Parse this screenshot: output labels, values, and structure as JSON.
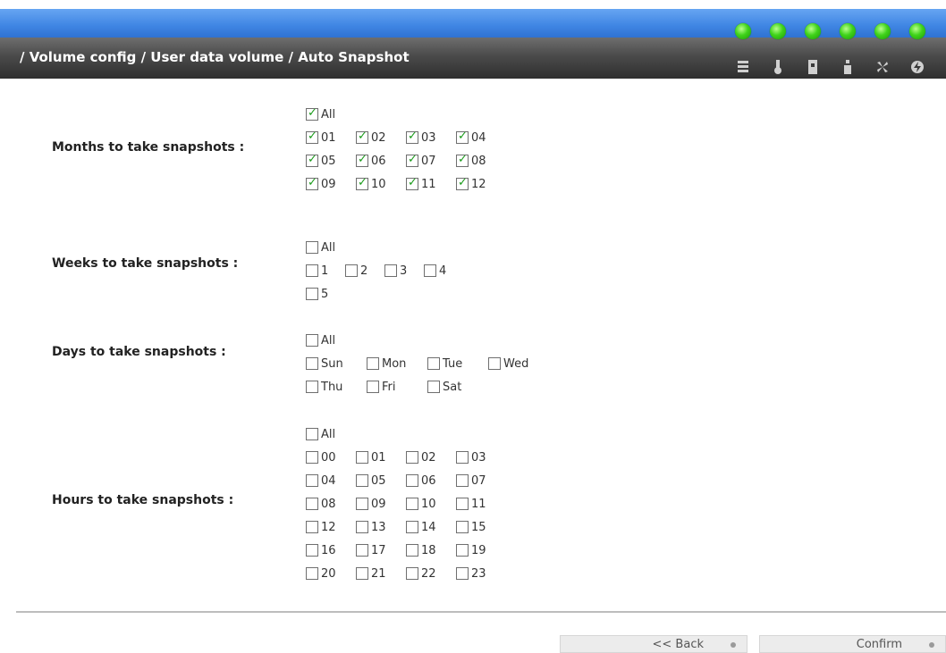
{
  "header": {
    "breadcrumb": "/ Volume config / User data volume / Auto Snapshot",
    "status_icons": [
      "disk-icon",
      "temperature-icon",
      "power-supply-icon",
      "ups-icon",
      "fan-icon",
      "voltage-icon"
    ],
    "led_color": "#3fd31a"
  },
  "months": {
    "label": "Months to take snapshots :",
    "all": {
      "label": "All",
      "checked": true
    },
    "options": [
      {
        "label": "01",
        "checked": true
      },
      {
        "label": "02",
        "checked": true
      },
      {
        "label": "03",
        "checked": true
      },
      {
        "label": "04",
        "checked": true
      },
      {
        "label": "05",
        "checked": true
      },
      {
        "label": "06",
        "checked": true
      },
      {
        "label": "07",
        "checked": true
      },
      {
        "label": "08",
        "checked": true
      },
      {
        "label": "09",
        "checked": true
      },
      {
        "label": "10",
        "checked": true
      },
      {
        "label": "11",
        "checked": true
      },
      {
        "label": "12",
        "checked": true
      }
    ]
  },
  "weeks": {
    "label": "Weeks to take snapshots :",
    "all": {
      "label": "All",
      "checked": false
    },
    "options": [
      {
        "label": "1",
        "checked": false
      },
      {
        "label": "2",
        "checked": false
      },
      {
        "label": "3",
        "checked": false
      },
      {
        "label": "4",
        "checked": false
      },
      {
        "label": "5",
        "checked": false
      }
    ]
  },
  "days": {
    "label": "Days to take snapshots :",
    "all": {
      "label": "All",
      "checked": false
    },
    "options": [
      {
        "label": "Sun",
        "checked": false
      },
      {
        "label": "Mon",
        "checked": false
      },
      {
        "label": "Tue",
        "checked": false
      },
      {
        "label": "Wed",
        "checked": false
      },
      {
        "label": "Thu",
        "checked": false
      },
      {
        "label": "Fri",
        "checked": false
      },
      {
        "label": "Sat",
        "checked": false
      }
    ]
  },
  "hours": {
    "label": "Hours to take snapshots :",
    "all": {
      "label": "All",
      "checked": false
    },
    "options": [
      {
        "label": "00",
        "checked": false
      },
      {
        "label": "01",
        "checked": false
      },
      {
        "label": "02",
        "checked": false
      },
      {
        "label": "03",
        "checked": false
      },
      {
        "label": "04",
        "checked": false
      },
      {
        "label": "05",
        "checked": false
      },
      {
        "label": "06",
        "checked": false
      },
      {
        "label": "07",
        "checked": false
      },
      {
        "label": "08",
        "checked": false
      },
      {
        "label": "09",
        "checked": false
      },
      {
        "label": "10",
        "checked": false
      },
      {
        "label": "11",
        "checked": false
      },
      {
        "label": "12",
        "checked": false
      },
      {
        "label": "13",
        "checked": false
      },
      {
        "label": "14",
        "checked": false
      },
      {
        "label": "15",
        "checked": false
      },
      {
        "label": "16",
        "checked": false
      },
      {
        "label": "17",
        "checked": false
      },
      {
        "label": "18",
        "checked": false
      },
      {
        "label": "19",
        "checked": false
      },
      {
        "label": "20",
        "checked": false
      },
      {
        "label": "21",
        "checked": false
      },
      {
        "label": "22",
        "checked": false
      },
      {
        "label": "23",
        "checked": false
      }
    ]
  },
  "buttons": {
    "back": "<< Back",
    "confirm": "Confirm"
  }
}
